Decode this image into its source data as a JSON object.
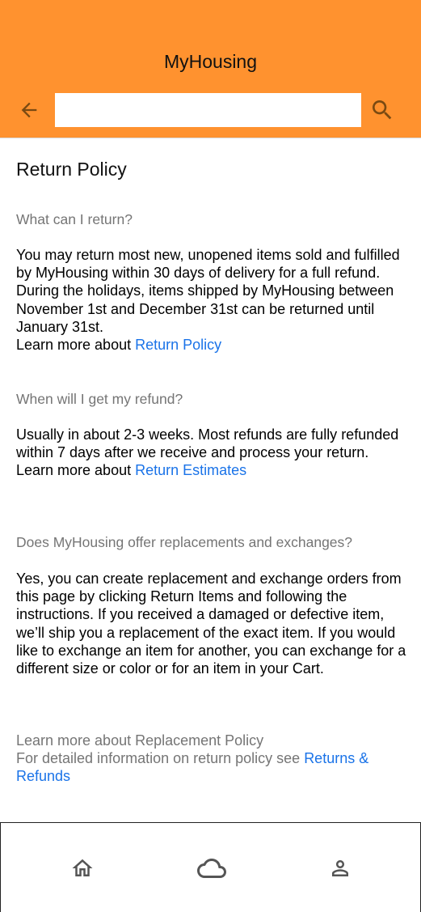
{
  "app": {
    "title": "MyHousing"
  },
  "search": {
    "placeholder": "",
    "value": ""
  },
  "icons": {
    "back": "arrow-back-icon",
    "search": "search-icon",
    "home": "home-icon",
    "cloud": "cloud-icon",
    "profile": "person-icon"
  },
  "colors": {
    "appbar": "#ff922f",
    "link": "#1a73e8",
    "muted": "#757575"
  },
  "page": {
    "title": "Return Policy"
  },
  "sections": [
    {
      "question": "What can I return?",
      "body": "You may return most new, unopened items sold and fulfilled by MyHousing within 30 days of delivery for a full refund. During the holidays, items shipped by MyHousing between November 1st and December 31st can be returned until January 31st.",
      "learn_prefix": "Learn more about ",
      "learn_link": "Return Policy"
    },
    {
      "question": "When will I get my refund?",
      "body": "Usually in about 2-3 weeks. Most refunds are fully refunded within 7 days after we receive and process your return.",
      "learn_prefix": "Learn more about ",
      "learn_link": "Return Estimates"
    },
    {
      "question": "Does MyHousing offer replacements and exchanges?",
      "body": "Yes, you can create replacement and exchange orders from this page by clicking Return Items and following the instructions. If you received a damaged or defective item, we’ll ship you a replacement of the exact item. If you would like to exchange an item for another, you can exchange for a different size or color or for an item in your Cart."
    }
  ],
  "footer": {
    "replacement_note": "Learn more about Replacement Policy",
    "detail_prefix": "For detailed information on return policy see ",
    "detail_link": "Returns & Refunds"
  }
}
